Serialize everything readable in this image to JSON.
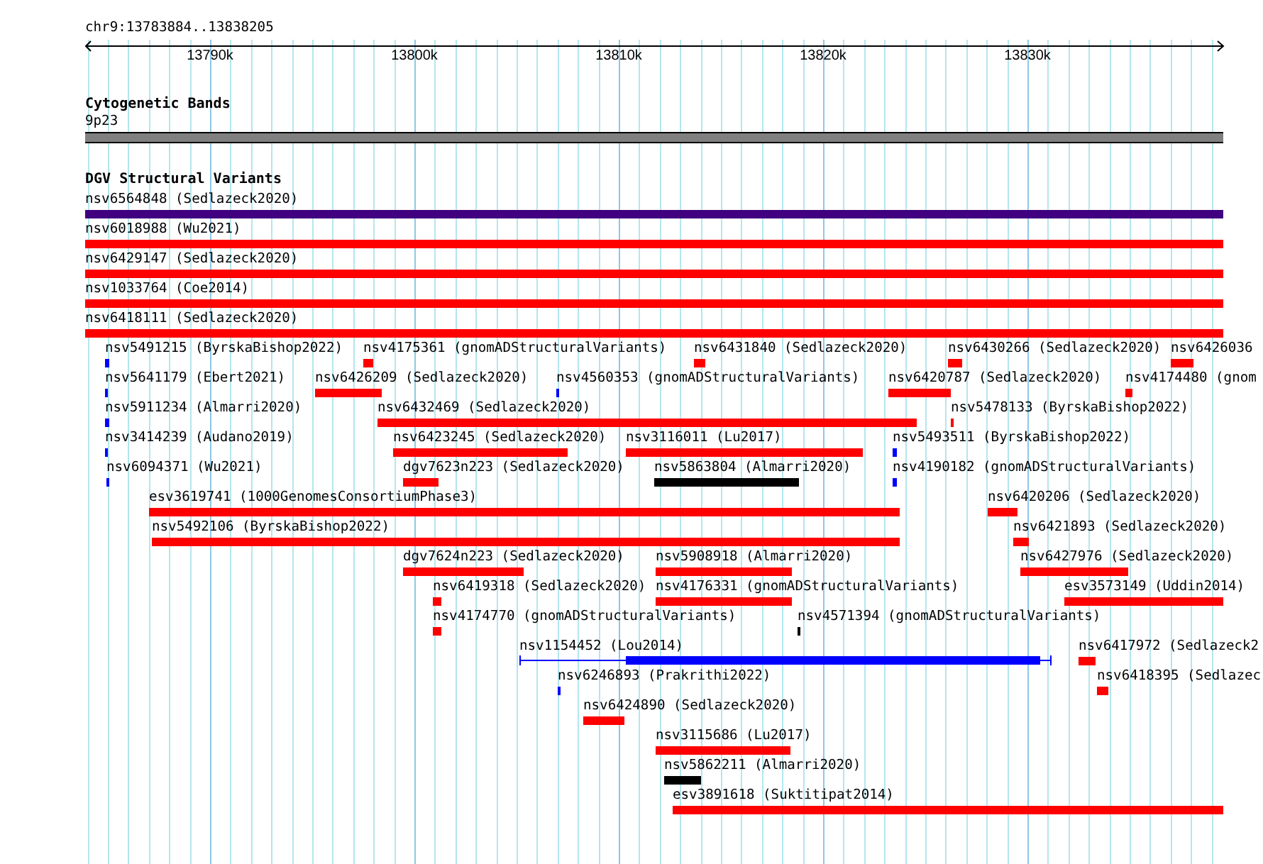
{
  "ruler": {
    "location": "chr9:13783884..13838205",
    "ticks": [
      "13790k",
      "13800k",
      "13810k",
      "13820k",
      "13830k"
    ]
  },
  "tracks": [
    {
      "title": "Cytogenetic Bands",
      "features": [
        {
          "label": "9p23",
          "kind": "band",
          "color": "#808080"
        }
      ]
    },
    {
      "title": "DGV Structural Variants",
      "features": [
        {
          "label": "nsv6564848 (Sedlazeck2020)",
          "kind": "bar",
          "color": "#400080"
        },
        {
          "label": "nsv6018988 (Wu2021)",
          "kind": "bar",
          "color": "#ff0000"
        },
        {
          "label": "nsv6429147 (Sedlazeck2020)",
          "kind": "bar",
          "color": "#ff0000"
        },
        {
          "label": "nsv1033764 (Coe2014)",
          "kind": "bar",
          "color": "#ff0000"
        },
        {
          "label": "nsv6418111 (Sedlazeck2020)",
          "kind": "bar",
          "color": "#ff0000"
        },
        {
          "label": "nsv5491215 (ByrskaBishop2022)",
          "kind": "bar",
          "color": "#0000ff"
        },
        {
          "label": "nsv4175361 (gnomADStructuralVariants)",
          "kind": "bar",
          "color": "#ff0000"
        },
        {
          "label": "nsv6431840 (Sedlazeck2020)",
          "kind": "bar",
          "color": "#ff0000"
        },
        {
          "label": "nsv6430266 (Sedlazeck2020)",
          "kind": "bar",
          "color": "#ff0000"
        },
        {
          "label": "nsv6426036",
          "kind": "bar",
          "color": "#ff0000"
        },
        {
          "label": "nsv5641179 (Ebert2021)",
          "kind": "bar",
          "color": "#0000ff"
        },
        {
          "label": "nsv6426209 (Sedlazeck2020)",
          "kind": "bar",
          "color": "#ff0000"
        },
        {
          "label": "nsv4560353 (gnomADStructuralVariants)",
          "kind": "bar",
          "color": "#0000ff"
        },
        {
          "label": "nsv6420787 (Sedlazeck2020)",
          "kind": "bar",
          "color": "#ff0000"
        },
        {
          "label": "nsv4174480 (gnom",
          "kind": "bar",
          "color": "#ff0000"
        },
        {
          "label": "nsv5911234 (Almarri2020)",
          "kind": "bar",
          "color": "#0000ff"
        },
        {
          "label": "nsv6432469 (Sedlazeck2020)",
          "kind": "bar",
          "color": "#ff0000"
        },
        {
          "label": "nsv5478133 (ByrskaBishop2022)",
          "kind": "bar",
          "color": "#ff0000"
        },
        {
          "label": "nsv3414239 (Audano2019)",
          "kind": "bar",
          "color": "#0000ff"
        },
        {
          "label": "nsv6423245 (Sedlazeck2020)",
          "kind": "bar",
          "color": "#ff0000"
        },
        {
          "label": "nsv3116011 (Lu2017)",
          "kind": "bar",
          "color": "#ff0000"
        },
        {
          "label": "nsv5493511 (ByrskaBishop2022)",
          "kind": "bar",
          "color": "#0000ff"
        },
        {
          "label": "nsv6094371 (Wu2021)",
          "kind": "bar",
          "color": "#0000ff"
        },
        {
          "label": "dgv7623n223 (Sedlazeck2020)",
          "kind": "bar",
          "color": "#ff0000"
        },
        {
          "label": "nsv5863804 (Almarri2020)",
          "kind": "bar",
          "color": "#000000"
        },
        {
          "label": "nsv4190182 (gnomADStructuralVariants)",
          "kind": "bar",
          "color": "#0000ff"
        },
        {
          "label": "esv3619741 (1000GenomesConsortiumPhase3)",
          "kind": "bar",
          "color": "#ff0000"
        },
        {
          "label": "nsv6420206 (Sedlazeck2020)",
          "kind": "bar",
          "color": "#ff0000"
        },
        {
          "label": "nsv5492106 (ByrskaBishop2022)",
          "kind": "bar",
          "color": "#ff0000"
        },
        {
          "label": "nsv6421893 (Sedlazeck2020)",
          "kind": "bar",
          "color": "#ff0000"
        },
        {
          "label": "dgv7624n223 (Sedlazeck2020)",
          "kind": "bar",
          "color": "#ff0000"
        },
        {
          "label": "nsv5908918 (Almarri2020)",
          "kind": "bar",
          "color": "#ff0000"
        },
        {
          "label": "nsv6427976 (Sedlazeck2020)",
          "kind": "bar",
          "color": "#ff0000"
        },
        {
          "label": "nsv6419318 (Sedlazeck2020)",
          "kind": "bar",
          "color": "#ff0000"
        },
        {
          "label": "nsv4176331 (gnomADStructuralVariants)",
          "kind": "bar",
          "color": "#ff0000"
        },
        {
          "label": "esv3573149 (Uddin2014)",
          "kind": "bar",
          "color": "#ff0000"
        },
        {
          "label": "nsv4174770 (gnomADStructuralVariants)",
          "kind": "bar",
          "color": "#ff0000"
        },
        {
          "label": "nsv4571394 (gnomADStructuralVariants)",
          "kind": "bar",
          "color": "#000000"
        },
        {
          "label": "nsv1154452 (Lou2014)",
          "kind": "gapped",
          "color": "#0000ff"
        },
        {
          "label": "nsv6417972 (Sedlazeck2",
          "kind": "bar",
          "color": "#ff0000"
        },
        {
          "label": "nsv6246893 (Prakrithi2022)",
          "kind": "bar",
          "color": "#0000ff"
        },
        {
          "label": "nsv6418395 (Sedlazec",
          "kind": "bar",
          "color": "#ff0000"
        },
        {
          "label": "nsv6424890 (Sedlazeck2020)",
          "kind": "bar",
          "color": "#ff0000"
        },
        {
          "label": "nsv3115686 (Lu2017)",
          "kind": "bar",
          "color": "#ff0000"
        },
        {
          "label": "nsv5862211 (Almarri2020)",
          "kind": "bar",
          "color": "#000000"
        },
        {
          "label": "esv3891618 (Suktitipat2014)",
          "kind": "bar",
          "color": "#ff0000"
        }
      ]
    }
  ]
}
